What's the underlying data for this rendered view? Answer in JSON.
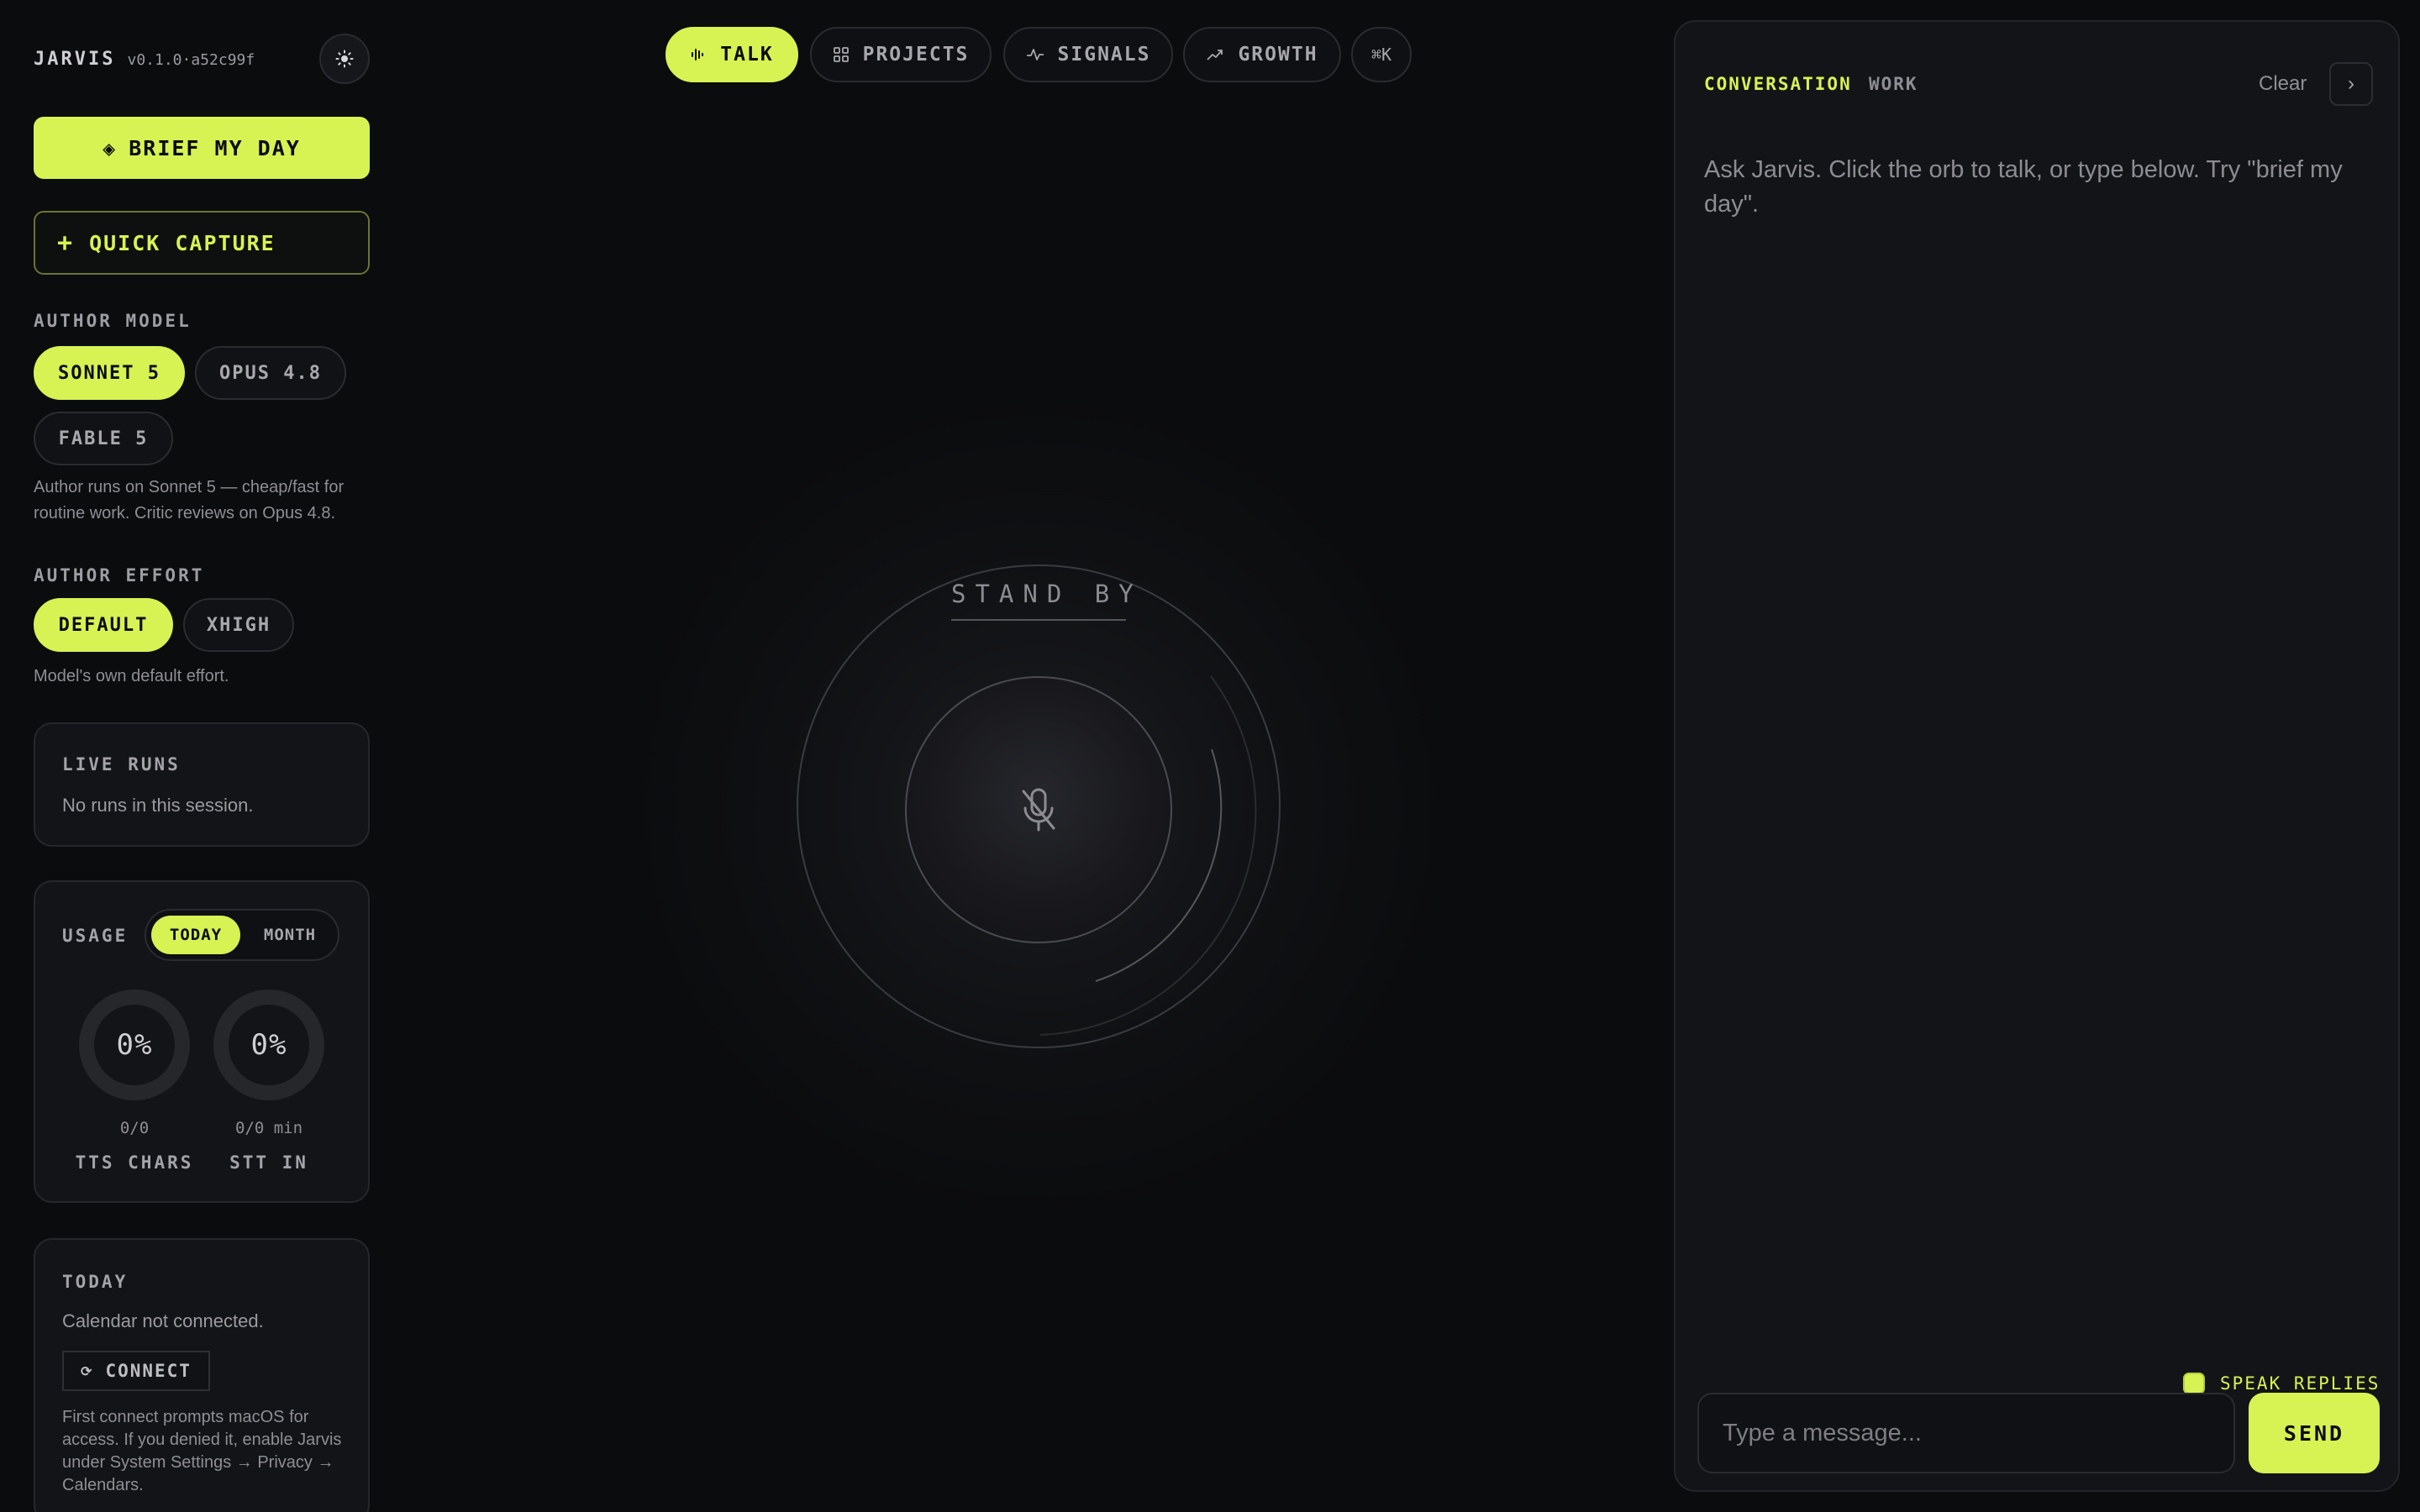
{
  "app": {
    "name": "JARVIS",
    "version": "v0.1.0·a52c99f"
  },
  "sidebar": {
    "theme_icon": "sun-icon",
    "brief_label": "BRIEF MY DAY",
    "brief_icon": "◈",
    "capture_label": "QUICK CAPTURE",
    "capture_icon": "+",
    "author_model": {
      "label": "AUTHOR MODEL",
      "options": [
        "SONNET 5",
        "OPUS 4.8",
        "FABLE 5"
      ],
      "selected": "SONNET 5",
      "help": "Author runs on Sonnet 5 — cheap/fast for routine work. Critic reviews on Opus 4.8."
    },
    "author_effort": {
      "label": "AUTHOR EFFORT",
      "options": [
        "DEFAULT",
        "XHIGH"
      ],
      "selected": "DEFAULT",
      "help": "Model's own default effort."
    },
    "live_runs": {
      "title": "LIVE RUNS",
      "text": "No runs in this session."
    },
    "usage": {
      "title": "USAGE",
      "tabs": [
        "TODAY",
        "MONTH"
      ],
      "selected": "TODAY",
      "gauges": [
        {
          "value": "0%",
          "sub": "0/0",
          "label": "TTS CHARS",
          "fraction": 0
        },
        {
          "value": "0%",
          "sub": "0/0 min",
          "label": "STT IN",
          "fraction": 0
        }
      ]
    },
    "today": {
      "title": "TODAY",
      "text": "Calendar not connected.",
      "connect_label": "CONNECT",
      "connect_icon": "⟳",
      "note": "First connect prompts macOS for access. If you denied it, enable Jarvis under System Settings → Privacy → Calendars."
    }
  },
  "nav": {
    "tabs": [
      {
        "label": "TALK",
        "icon": "waveform-icon",
        "active": true
      },
      {
        "label": "PROJECTS",
        "icon": "grid-icon",
        "active": false
      },
      {
        "label": "SIGNALS",
        "icon": "pulse-icon",
        "active": false
      },
      {
        "label": "GROWTH",
        "icon": "trend-up-icon",
        "active": false
      }
    ],
    "shortcut": "⌘K"
  },
  "orb": {
    "status": "STAND BY",
    "icon": "mic-off-icon"
  },
  "panel": {
    "tabs": [
      "CONVERSATION",
      "WORK"
    ],
    "active_tab": "CONVERSATION",
    "clear_label": "Clear",
    "collapse_icon": "›",
    "empty_message": "Ask Jarvis. Click the orb to talk, or type below. Try \"brief my day\".",
    "speak_label": "SPEAK REPLIES",
    "speak_checked": true,
    "input_placeholder": "Type a message...",
    "send_label": "SEND"
  },
  "colors": {
    "accent": "#d7f253",
    "background": "#0b0c0e",
    "panel": "#131418"
  }
}
